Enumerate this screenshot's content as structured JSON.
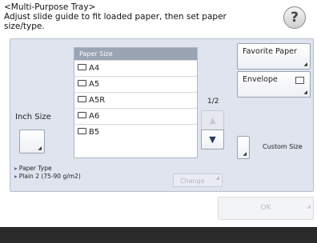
{
  "header": {
    "title": "<Multi-Purpose Tray>",
    "instruction": "Adjust slide guide to fit loaded paper, then set paper size/type."
  },
  "help_label": "?",
  "inch": {
    "label": "Inch Size"
  },
  "list": {
    "header": "Paper Size",
    "items": [
      "A4",
      "A5",
      "A5R",
      "A6",
      "B5"
    ],
    "page": "1/2"
  },
  "scroll": {
    "up_symbol": "▲",
    "down_symbol": "▼"
  },
  "buttons": {
    "favorite": "Favorite Paper",
    "envelope": "Envelope",
    "custom_size": "Custom Size",
    "change": "Change",
    "ok": "OK"
  },
  "paper_type": {
    "label": "Paper Type",
    "value": "Plain 2 (75-90 g/m2)"
  }
}
